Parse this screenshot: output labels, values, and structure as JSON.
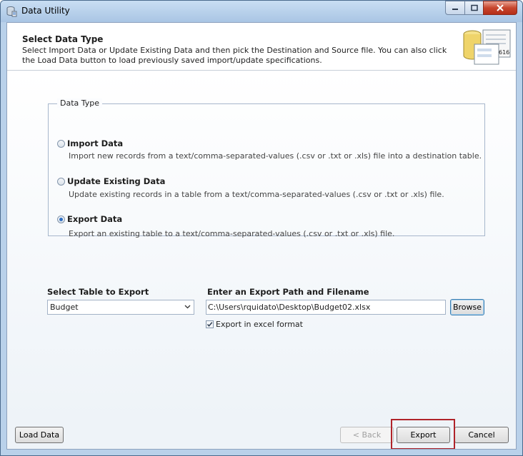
{
  "window": {
    "title": "Data Utility",
    "icon": "data-utility-icon"
  },
  "header": {
    "title": "Select Data Type",
    "description": "Select Import Data or Update Existing Data and then pick the Destination and Source file.  You can also click the Load Data button to load previously saved import/update specifications.",
    "art_text": "616"
  },
  "data_type": {
    "legend": "Data Type",
    "options": [
      {
        "label": "Import Data",
        "description": "Import new records from a text/comma-separated-values (.csv or .txt or .xls) file into a destination table.",
        "checked": false
      },
      {
        "label": "Update Existing Data",
        "description": "Update existing records in a table from a text/comma-separated-values (.csv or .txt or .xls) file.",
        "checked": false
      },
      {
        "label": "Export Data",
        "description": "Export an existing table to a text/comma-separated-values (.csv or .txt or .xls) file.",
        "checked": true
      }
    ]
  },
  "export": {
    "table_label": "Select Table to Export",
    "table_value": "Budget",
    "path_label": "Enter an Export Path and Filename",
    "path_value": "C:\\Users\\rquidato\\Desktop\\Budget02.xlsx",
    "browse_label": "Browse",
    "excel_label": "Export in excel format",
    "excel_checked": true
  },
  "footer": {
    "load_label": "Load Data",
    "back_label": "< Back",
    "export_label": "Export",
    "cancel_label": "Cancel"
  },
  "colors": {
    "highlight": "#b0232a",
    "accent": "#2e6fc4"
  }
}
